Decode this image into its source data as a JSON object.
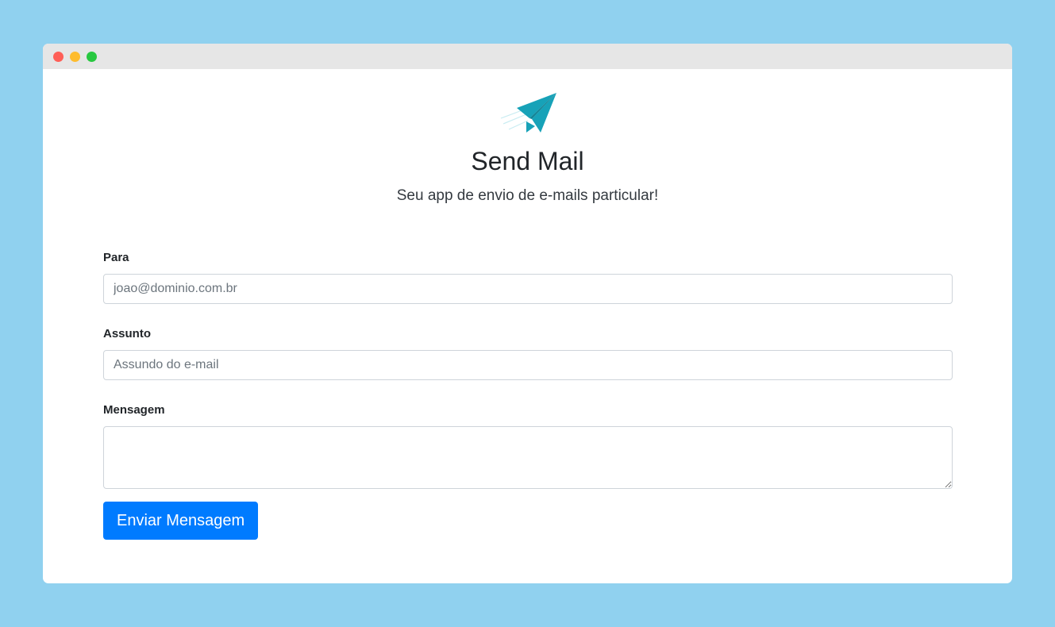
{
  "window": {
    "controls": [
      {
        "name": "close",
        "color": "#ff5f57"
      },
      {
        "name": "minimize",
        "color": "#febc2e"
      },
      {
        "name": "maximize",
        "color": "#28c840"
      }
    ]
  },
  "header": {
    "logo_icon": "paper-plane-icon",
    "logo_color": "#17a2b8",
    "title": "Send Mail",
    "subtitle": "Seu app de envio de e-mails particular!"
  },
  "form": {
    "to": {
      "label": "Para",
      "placeholder": "joao@dominio.com.br",
      "value": ""
    },
    "subject": {
      "label": "Assunto",
      "placeholder": "Assundo do e-mail",
      "value": ""
    },
    "message": {
      "label": "Mensagem",
      "placeholder": "",
      "value": ""
    },
    "submit_label": "Enviar Mensagem",
    "submit_color": "#007bff"
  }
}
